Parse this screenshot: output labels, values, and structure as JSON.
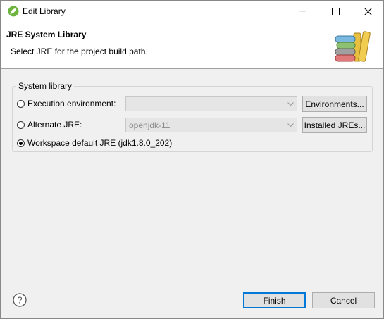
{
  "window": {
    "title": "Edit Library",
    "icon": "eclipse-spring-icon"
  },
  "header": {
    "title": "JRE System Library",
    "description": "Select JRE for the project build path.",
    "image": "books-library-icon"
  },
  "group": {
    "label": "System library",
    "options": [
      {
        "label": "Execution environment:",
        "checked": false
      },
      {
        "label": "Alternate JRE:",
        "checked": false
      },
      {
        "label": "Workspace default JRE (jdk1.8.0_202)",
        "checked": true
      }
    ],
    "execution_env_value": "",
    "alternate_jre_value": "openjdk-11",
    "environments_button": "Environments...",
    "installed_jres_button": "Installed JREs..."
  },
  "footer": {
    "help_icon": "help-icon",
    "finish_label": "Finish",
    "cancel_label": "Cancel"
  }
}
